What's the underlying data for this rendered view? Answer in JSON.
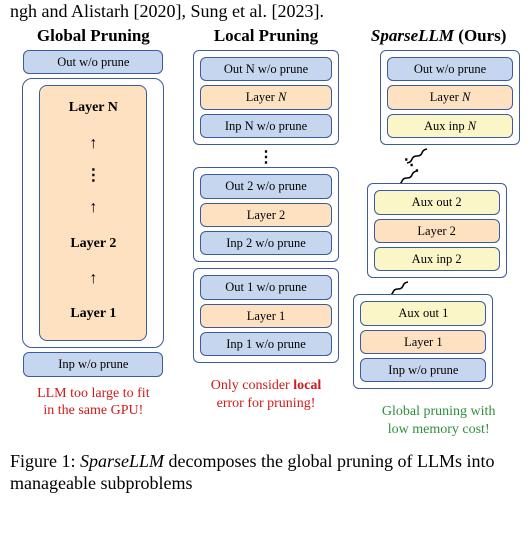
{
  "top_cut_text": "ngh and Alistarh [2020], Sung et al. [2023].",
  "columns": {
    "global": {
      "title": "Global Pruning",
      "out": "Out w/o prune",
      "inp": "Inp w/o prune",
      "layer_n": "Layer 𝑁",
      "layer_2": "Layer 2",
      "layer_1": "Layer 1",
      "note_line1": "LLM too large to fit",
      "note_line2": "in the same GPU!"
    },
    "local": {
      "title": "Local Pruning",
      "groups": [
        {
          "out": "Out N w/o prune",
          "layer": "Layer 𝑁",
          "inp": "Inp N w/o prune"
        },
        {
          "out": "Out 2 w/o prune",
          "layer": "Layer 2",
          "inp": "Inp 2 w/o prune"
        },
        {
          "out": "Out 1 w/o prune",
          "layer": "Layer 1",
          "inp": "Inp 1 w/o prune"
        }
      ],
      "note_pre": "Only consider ",
      "note_bold": "local",
      "note_post": " error for pruning!"
    },
    "sparse": {
      "title_italic": "SparseLLM",
      "title_rest": " (Ours)",
      "groups": [
        {
          "out": "Out w/o prune",
          "layer": "Layer 𝑁",
          "inp": "Aux inp 𝑁"
        },
        {
          "out": "Aux out 2",
          "layer": "Layer 2",
          "inp": "Aux inp 2"
        },
        {
          "out": "Aux out 1",
          "layer": "Layer 1",
          "inp": "Inp w/o prune"
        }
      ],
      "note_line1": "Global pruning with",
      "note_line2": "low memory cost!"
    }
  },
  "caption_pre": "Figure 1: ",
  "caption_italic": "SparseLLM",
  "caption_rest": " decomposes the global pruning of LLMs into manageable subproblems"
}
